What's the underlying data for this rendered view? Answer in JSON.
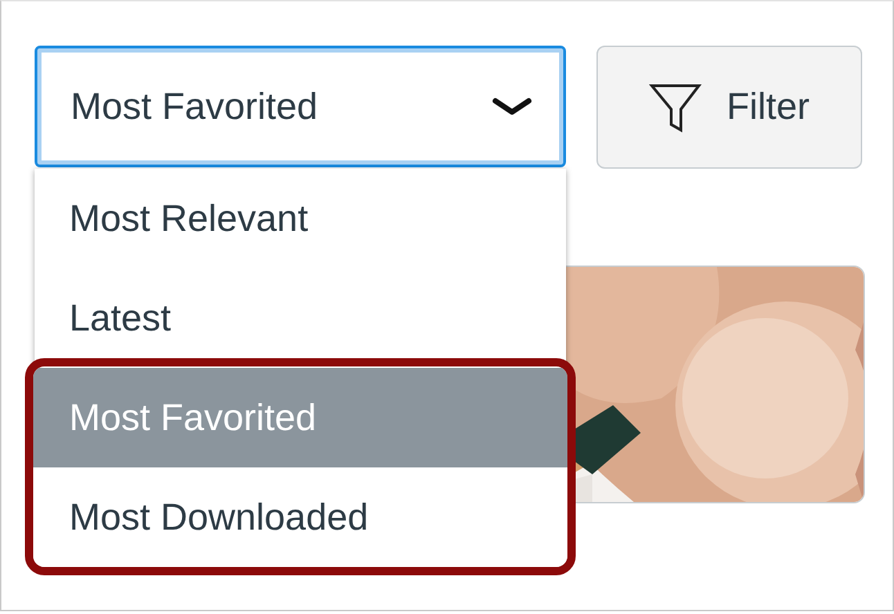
{
  "sort_select": {
    "value": "Most Favorited",
    "expanded": true
  },
  "sort_options": [
    {
      "label": "Most Relevant",
      "selected": false,
      "highlighted": false
    },
    {
      "label": "Latest",
      "selected": false,
      "highlighted": false
    },
    {
      "label": "Most Favorited",
      "selected": true,
      "highlighted": true
    },
    {
      "label": "Most Downloaded",
      "selected": false,
      "highlighted": true
    }
  ],
  "filter_button": {
    "label": "Filter"
  }
}
